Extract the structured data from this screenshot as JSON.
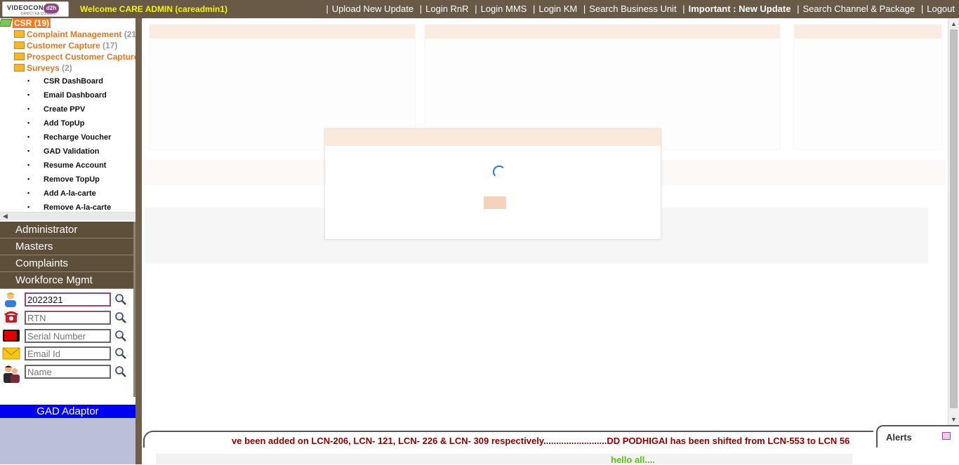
{
  "header": {
    "logo_text": "VIDEOCON",
    "logo_badge": "d2h",
    "logo_tagline": "DIRECT KA CONNECT",
    "welcome": "Welcome CARE ADMIN (careadmin1)",
    "nav": [
      "Upload New Update",
      "Login RnR",
      "Login MMS",
      "Login KM",
      "Search Business Unit",
      "Important : New Update",
      "Search Channel & Package",
      "Logout"
    ],
    "separator": "|"
  },
  "sidebar": {
    "root": {
      "label": "CSR",
      "count": "(19)"
    },
    "folders": [
      {
        "label": "Complaint Management",
        "count": "(21)"
      },
      {
        "label": "Customer Capture",
        "count": "(17)"
      },
      {
        "label": "Prospect Customer Capture",
        "count": "("
      },
      {
        "label": "Surveys",
        "count": "(2)"
      }
    ],
    "items": [
      "CSR DashBoard",
      "Email Dashboard",
      "Create PPV",
      "Add TopUp",
      "Recharge Voucher",
      "GAD Validation",
      "Resume Account",
      "Remove TopUp",
      "Add A-la-carte",
      "Remove A-la-carte"
    ],
    "menu": [
      "Administrator",
      "Masters",
      "Complaints",
      "Workforce Mgmt"
    ],
    "search": {
      "customer_id_value": "2022321",
      "rtn_placeholder": "RTN",
      "serial_placeholder": "Serial Number",
      "email_placeholder": "Email Id",
      "name_placeholder": "Name"
    },
    "gad_adaptor": "GAD Adaptor"
  },
  "ticker": {
    "message": "ve been added on LCN-206, LCN- 121, LCN- 226 & LCN- 309 respectively.........................DD PODHIGAI has been shifted from LCN-553 to LCN 56",
    "alerts_label": "Alerts",
    "hello": "hello all...."
  },
  "colors": {
    "topbar": "#685a47",
    "welcome": "#f6f600",
    "csr_badge": "#f57b21",
    "folder_text": "#e8741c",
    "gad": "#0000f0",
    "ticker_text": "#8b0000",
    "hello": "#58c21a"
  }
}
